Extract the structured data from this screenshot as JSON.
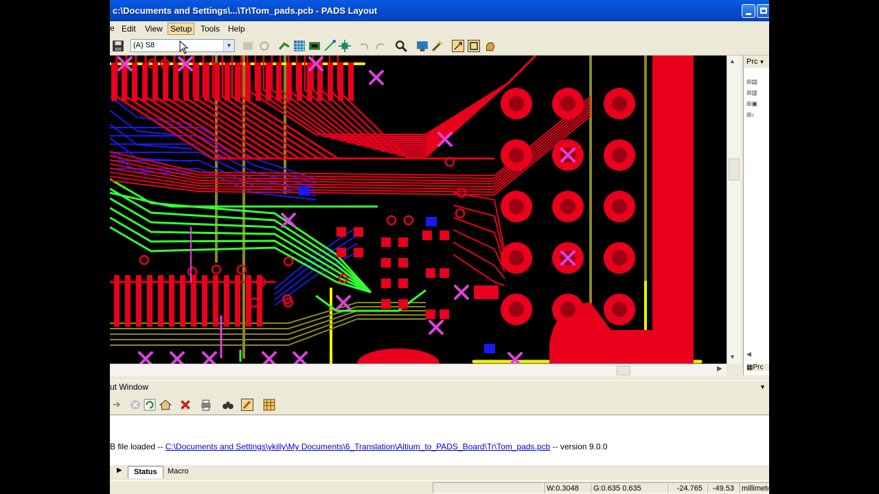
{
  "window": {
    "title": "c:\\Documents and Settings\\...\\Tr\\Tom_pads.pcb - PADS Layout"
  },
  "menu": {
    "items": [
      "Edit",
      "View",
      "Setup",
      "Tools",
      "Help"
    ],
    "active": "Setup"
  },
  "toolbar": {
    "layer_combo_value": "(A) S8"
  },
  "project_panel": {
    "header": "Prc"
  },
  "output_window": {
    "title": "ut Window",
    "message_prefix": "B file loaded --",
    "message_path": "C:\\Documents and Settings\\ykilly\\My Documents\\6_Translation\\Altium_to_PADS_Board\\Tr\\Tom_pads.pcb",
    "message_suffix": "-- version 9.0.0",
    "tabs": [
      "Status",
      "Macro"
    ],
    "active_tab": "Status"
  },
  "statusbar": {
    "width": "W:0.3048",
    "grid": "G:0.635 0.635",
    "x": "-24.765",
    "y": "-49.53",
    "units": "millimete"
  },
  "colors": {
    "trace_red": "#E8001C",
    "trace_green": "#33FF33",
    "trace_blue": "#1A1AEE",
    "olive": "#8A8A1E",
    "via_magenta": "#E040E0",
    "yellow": "#F0F000"
  }
}
